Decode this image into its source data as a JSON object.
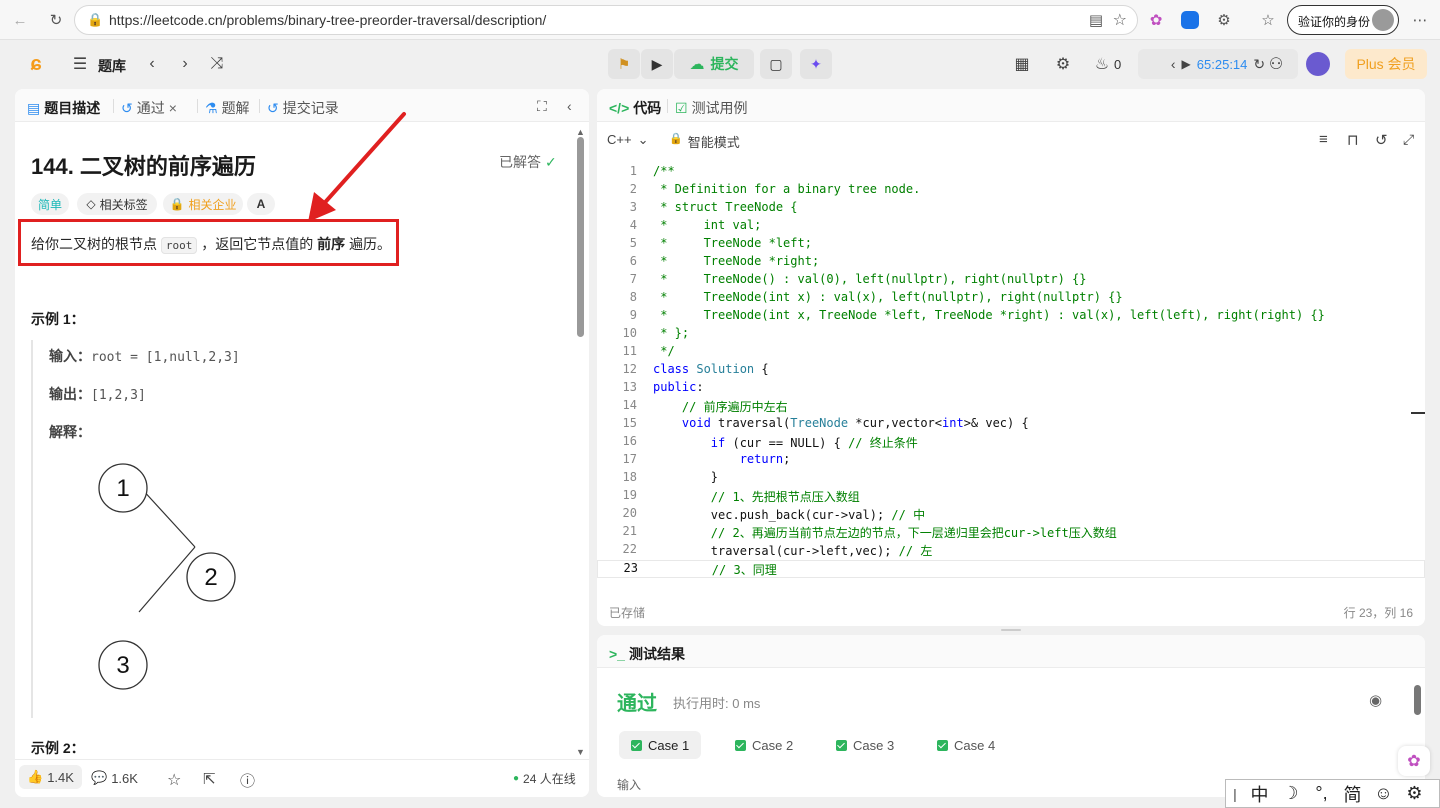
{
  "browser": {
    "url": "https://leetcode.cn/problems/binary-tree-preorder-traversal/description/",
    "profile_label": "验证你的身份"
  },
  "topbar": {
    "problem_bank": "题库",
    "submit_label": "提交",
    "streak_count": "0",
    "timer": "65:25:14",
    "plus_label": "Plus 会员"
  },
  "left": {
    "tabs": [
      "题目描述",
      "通过",
      "题解",
      "提交记录"
    ],
    "title": "144. 二叉树的前序遍历",
    "solved_label": "已解答",
    "chips": {
      "difficulty": "简单",
      "tags": "相关标签",
      "companies": "相关企业",
      "translate": "A"
    },
    "desc_prefix": "给你二叉树的根节点",
    "desc_code": "root",
    "desc_mid": "，返回它节点值的",
    "desc_bold": "前序",
    "desc_suffix": "遍历。",
    "example1_heading": "示例 1：",
    "input_label": "输入：",
    "input_value": "root = [1,null,2,3]",
    "output_label": "输出：",
    "output_value": "[1,2,3]",
    "explain_label": "解释：",
    "tree_nodes": [
      "1",
      "2",
      "3"
    ],
    "example2_heading": "示例 2：",
    "likes": "1.4K",
    "comments": "1.6K",
    "online": "24 人在线"
  },
  "code": {
    "tabs": [
      "代码",
      "测试用例"
    ],
    "language": "C++",
    "mode": "智能模式",
    "status_saved": "已存储",
    "cursor_pos": "行 23，列 16",
    "current_line": 23,
    "lines": [
      [
        {
          "c": "cmt",
          "t": "/**"
        }
      ],
      [
        {
          "c": "cmt",
          "t": " * Definition for a binary tree node."
        }
      ],
      [
        {
          "c": "cmt",
          "t": " * struct TreeNode {"
        }
      ],
      [
        {
          "c": "cmt",
          "t": " *     int val;"
        }
      ],
      [
        {
          "c": "cmt",
          "t": " *     TreeNode *left;"
        }
      ],
      [
        {
          "c": "cmt",
          "t": " *     TreeNode *right;"
        }
      ],
      [
        {
          "c": "cmt",
          "t": " *     TreeNode() : val(0), left(nullptr), right(nullptr) {}"
        }
      ],
      [
        {
          "c": "cmt",
          "t": " *     TreeNode(int x) : val(x), left(nullptr), right(nullptr) {}"
        }
      ],
      [
        {
          "c": "cmt",
          "t": " *     TreeNode(int x, TreeNode *left, TreeNode *right) : val(x), left(left), right(right) {}"
        }
      ],
      [
        {
          "c": "cmt",
          "t": " * };"
        }
      ],
      [
        {
          "c": "cmt",
          "t": " */"
        }
      ],
      [
        {
          "c": "kw",
          "t": "class "
        },
        {
          "c": "ty",
          "t": "Solution"
        },
        {
          "c": "tx",
          "t": " {"
        }
      ],
      [
        {
          "c": "kw",
          "t": "public"
        },
        {
          "c": "tx",
          "t": ":"
        }
      ],
      [
        {
          "c": "tx",
          "t": "    "
        },
        {
          "c": "cmt",
          "t": "// 前序遍历中左右"
        }
      ],
      [
        {
          "c": "tx",
          "t": "    "
        },
        {
          "c": "kw",
          "t": "void "
        },
        {
          "c": "tx",
          "t": "traversal("
        },
        {
          "c": "ty",
          "t": "TreeNode"
        },
        {
          "c": "tx",
          "t": " *cur,vector<"
        },
        {
          "c": "kw",
          "t": "int"
        },
        {
          "c": "tx",
          "t": ">& vec) {"
        }
      ],
      [
        {
          "c": "tx",
          "t": "        "
        },
        {
          "c": "kw",
          "t": "if"
        },
        {
          "c": "tx",
          "t": " (cur == NULL) { "
        },
        {
          "c": "cmt",
          "t": "// 终止条件"
        }
      ],
      [
        {
          "c": "tx",
          "t": "            "
        },
        {
          "c": "kw",
          "t": "return"
        },
        {
          "c": "tx",
          "t": ";"
        }
      ],
      [
        {
          "c": "tx",
          "t": "        }"
        }
      ],
      [
        {
          "c": "tx",
          "t": "        "
        },
        {
          "c": "cmt",
          "t": "// 1、先把根节点压入数组"
        }
      ],
      [
        {
          "c": "tx",
          "t": "        vec.push_back(cur->val); "
        },
        {
          "c": "cmt",
          "t": "// 中"
        }
      ],
      [
        {
          "c": "tx",
          "t": "        "
        },
        {
          "c": "cmt",
          "t": "// 2、再遍历当前节点左边的节点，下一层递归里会把cur->left压入数组"
        }
      ],
      [
        {
          "c": "tx",
          "t": "        traversal(cur->left,vec); "
        },
        {
          "c": "cmt",
          "t": "// 左"
        }
      ],
      [
        {
          "c": "tx",
          "t": "        "
        },
        {
          "c": "cmt",
          "t": "// 3、同理"
        }
      ]
    ]
  },
  "result": {
    "heading": "测试结果",
    "status": "通过",
    "runtime": "执行用时: 0 ms",
    "cases": [
      "Case 1",
      "Case 2",
      "Case 3",
      "Case 4"
    ],
    "input_label": "输入"
  },
  "ime": [
    "中",
    "☽",
    "°,",
    "简",
    "☺",
    "⚙"
  ]
}
